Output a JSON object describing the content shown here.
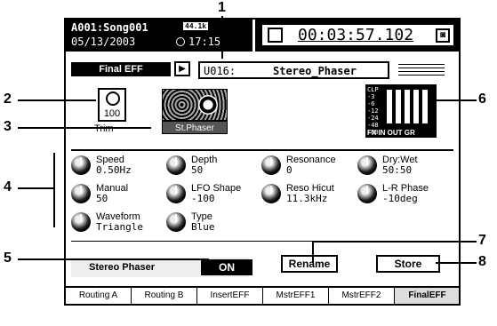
{
  "header": {
    "song": "A001:Song001",
    "date": "05/13/2003",
    "sample_rate": "44.1k",
    "time": "17:15",
    "counter": "00:03:57.102"
  },
  "effect": {
    "title": "Final EFF",
    "preset_number": "U016:",
    "preset_name": "Stereo_Phaser",
    "trim_value": "100",
    "trim_label": "Trim",
    "algorithm_button": "St.Phaser"
  },
  "meter": {
    "scale": [
      "CLP",
      "-3",
      "-6",
      "-12",
      "-24",
      "-48",
      "-60"
    ],
    "footer": "FX IN OUT GR"
  },
  "params": [
    {
      "label": "Speed",
      "value": "0.50Hz"
    },
    {
      "label": "Depth",
      "value": "50"
    },
    {
      "label": "Resonance",
      "value": "0"
    },
    {
      "label": "Dry:Wet",
      "value": "50:50"
    },
    {
      "label": "Manual",
      "value": "50"
    },
    {
      "label": "LFO Shape",
      "value": "-100"
    },
    {
      "label": "Reso Hicut",
      "value": "11.3kHz"
    },
    {
      "label": "L-R Phase",
      "value": "-10deg"
    },
    {
      "label": "Waveform",
      "value": "Triangle"
    },
    {
      "label": "Type",
      "value": "Blue"
    }
  ],
  "footer": {
    "status_label": "Stereo Phaser",
    "on_button": "ON",
    "rename_button": "Rename",
    "store_button": "Store"
  },
  "tabs": [
    "Routing A",
    "Routing B",
    "InsertEFF",
    "MstrEFF1",
    "MstrEFF2",
    "FinalEFF"
  ],
  "callouts": [
    "1",
    "2",
    "3",
    "4",
    "5",
    "6",
    "7",
    "8"
  ]
}
